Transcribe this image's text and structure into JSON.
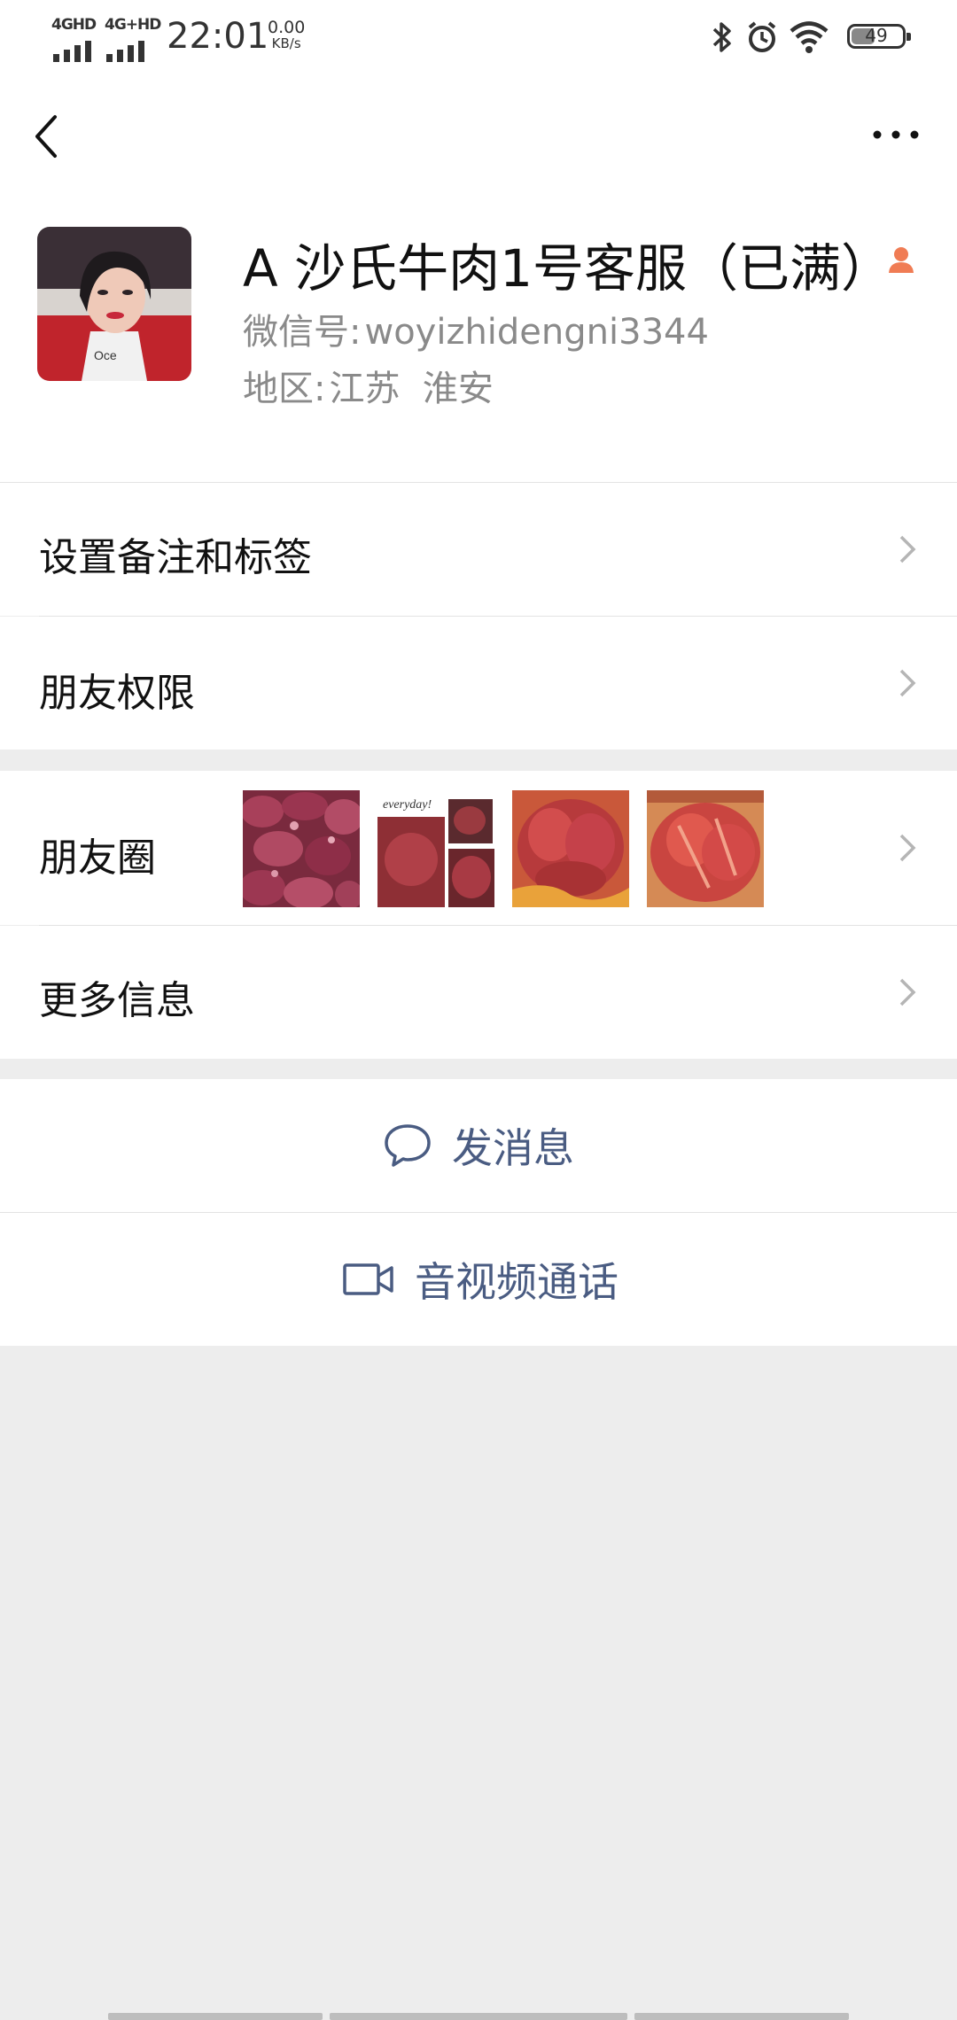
{
  "status_bar": {
    "signal1_label": "4GHD",
    "signal2_label": "4G+HD",
    "time": "22:01",
    "net_speed_value": "0.00",
    "net_speed_unit": "KB/s",
    "battery_level": "49",
    "icons": [
      "bluetooth-icon",
      "alarm-icon",
      "wifi-icon",
      "battery-icon"
    ]
  },
  "nav": {
    "back_icon": "back-icon",
    "more_icon": "more-icon"
  },
  "profile": {
    "name": "A 沙氏牛肉1号客服（已满）",
    "wechat_id_label": "微信号:",
    "wechat_id_value": "woyizhidengni3344",
    "region_label": "地区:",
    "region_value": "江苏  淮安",
    "gender_icon": "female-person-icon"
  },
  "menu": {
    "set_remark": "设置备注和标签",
    "friend_permissions": "朋友权限",
    "moments": "朋友圈",
    "more_info": "更多信息"
  },
  "moments_thumb_text": "everyday!",
  "actions": {
    "send_message": "发消息",
    "av_call": "音视频通话"
  },
  "colors": {
    "background": "#ededed",
    "link_blue": "#4a5c82",
    "secondary_text": "#8a8a8a",
    "accent_orange": "#f07c54"
  }
}
